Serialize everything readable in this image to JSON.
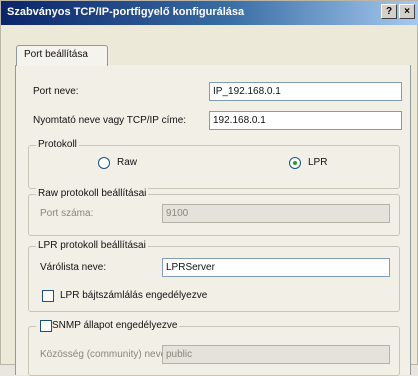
{
  "window": {
    "title": "Szabványos TCP/IP-portfigyelő konfigurálása",
    "help_glyph": "?",
    "close_glyph": "×"
  },
  "tabs": [
    {
      "label": "Port beállítása"
    }
  ],
  "form": {
    "port_name_label": "Port neve:",
    "port_name_value": "IP_192.168.0.1",
    "printer_name_label": "Nyomtató neve vagy TCP/IP címe:",
    "printer_name_value": "192.168.0.1"
  },
  "protocol_group": {
    "title": "Protokoll",
    "raw_label": "Raw",
    "lpr_label": "LPR",
    "selected": "LPR"
  },
  "raw_settings": {
    "title": "Raw protokoll beállításai",
    "port_number_label": "Port száma:",
    "port_number_value": "9100"
  },
  "lpr_settings": {
    "title": "LPR protokoll beállításai",
    "queue_name_label": "Várólista neve:",
    "queue_name_value": "LPRServer",
    "byte_counting_label": "LPR bájtszámlálás engedélyezve",
    "byte_counting_checked": false
  },
  "snmp": {
    "title": "SNMP állapot engedélyezve",
    "checked": false,
    "community_label": "Közösség (community) neve:",
    "community_value": "public"
  }
}
